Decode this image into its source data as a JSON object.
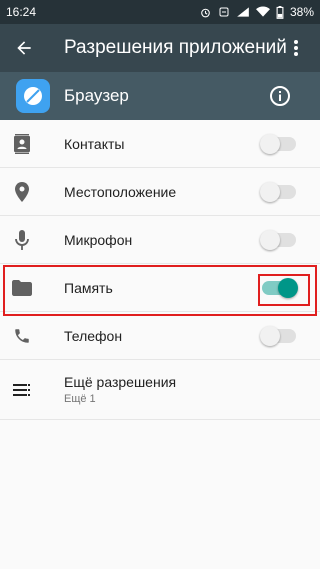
{
  "status_bar": {
    "time": "16:24",
    "battery": "38%"
  },
  "toolbar": {
    "title": "Разрешения приложений"
  },
  "app_header": {
    "name": "Браузер"
  },
  "permissions": [
    {
      "label": "Контакты",
      "enabled": false
    },
    {
      "label": "Местоположение",
      "enabled": false
    },
    {
      "label": "Микрофон",
      "enabled": false
    },
    {
      "label": "Память",
      "enabled": true
    },
    {
      "label": "Телефон",
      "enabled": false
    }
  ],
  "more": {
    "label": "Ещё разрешения",
    "sub": "Ещё 1"
  },
  "colors": {
    "accent": "#009688",
    "highlight": "#e01e1e",
    "toolbar": "#37474f",
    "app_header": "#455a64"
  }
}
